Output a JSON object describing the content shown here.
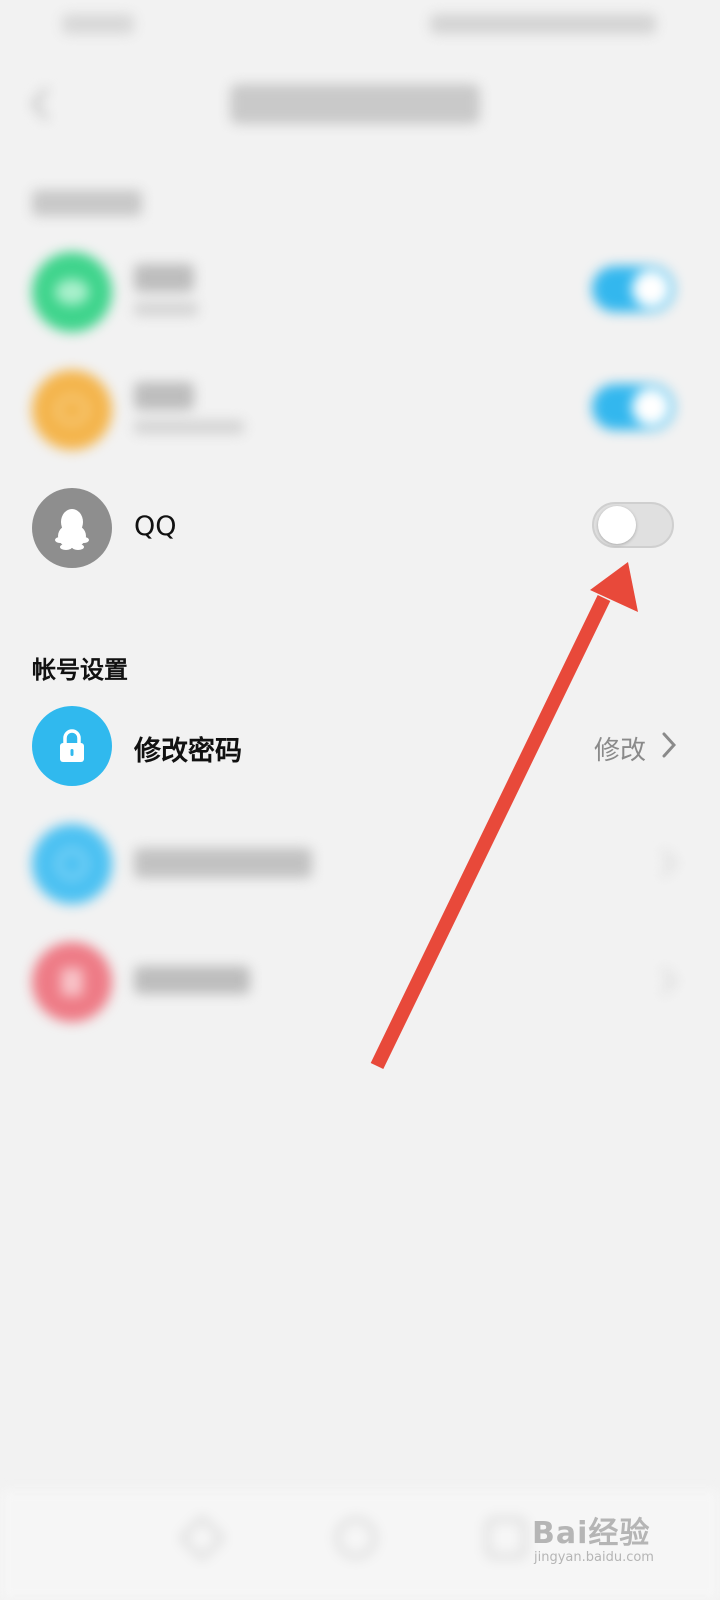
{
  "bindings": {
    "qq": {
      "label": "QQ",
      "enabled": false
    }
  },
  "account_settings": {
    "section_title": "帐号设置",
    "change_password": {
      "title": "修改密码",
      "action_label": "修改"
    }
  },
  "watermark": {
    "brand": "Bai经验",
    "url": "jingyan.baidu.com"
  },
  "colors": {
    "toggle_on": "#33b7ee",
    "wechat_green": "#3fd48c",
    "weibo_orange": "#f4b54d",
    "qq_gray": "#8e8e8e",
    "lock_blue": "#30b9ee",
    "device_blue": "#4cc1f2",
    "delete_red": "#ee7b86",
    "annotation_arrow": "#e8493a"
  },
  "icons": {
    "wechat": "wechat-icon",
    "weibo": "weibo-icon",
    "qq": "qq-penguin-icon",
    "lock": "lock-icon",
    "chevron": "chevron-right-icon",
    "back": "back-arrow-icon"
  }
}
